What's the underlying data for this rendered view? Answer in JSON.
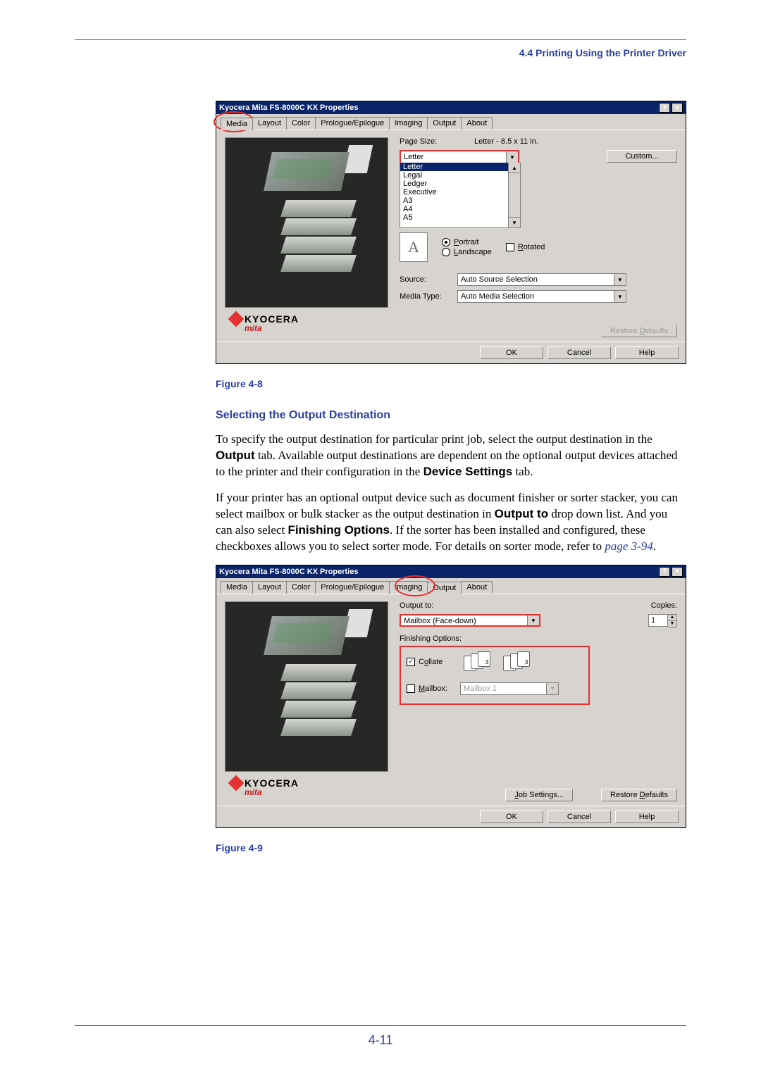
{
  "header": {
    "section": "4.4 Printing Using the Printer Driver"
  },
  "dialog1": {
    "title": "Kyocera Mita FS-8000C KX Properties",
    "tabs": [
      "Media",
      "Layout",
      "Color",
      "Prologue/Epilogue",
      "Imaging",
      "Output",
      "About"
    ],
    "active_tab_index": 0,
    "page_size_label": "Page Size:",
    "page_size_info": "Letter - 8.5 x 11 in.",
    "page_size_selected": "Letter",
    "page_size_options": [
      "Letter",
      "Legal",
      "Ledger",
      "Executive",
      "A3",
      "A4",
      "A5"
    ],
    "custom_btn": "Custom...",
    "orientation_glyph": "A",
    "portrait": "Portrait",
    "landscape": "Landscape",
    "rotated": "Rotated",
    "source_label": "Source:",
    "source_value": "Auto Source Selection",
    "media_type_label": "Media Type:",
    "media_type_value": "Auto Media Selection",
    "logo_top": "KYOCERA",
    "logo_bottom": "mita",
    "restore_defaults": "Restore Defaults",
    "ok": "OK",
    "cancel": "Cancel",
    "help": "Help"
  },
  "fig1_caption": "Figure 4-8",
  "section_title": "Selecting the Output Destination",
  "p1a": "To specify the output destination for particular print job, select the output destination in the ",
  "p1b": "Output",
  "p1c": " tab. Available output destinations are dependent on the optional output devices attached to the printer and their configuration in the ",
  "p1d": "Device Settings",
  "p1e": " tab.",
  "p2a": "If your printer has an optional output device such as document finisher or sorter stacker, you can select mailbox or bulk stacker as the output destination in  ",
  "p2b": "Output to",
  "p2c": " drop down list. And you can also select ",
  "p2d": "Finishing Options",
  "p2e": ". If the sorter has been installed and configured, these checkboxes allows you to select sorter mode. For details on sorter mode, refer to ",
  "p2f": "page 3-94",
  "p2g": ".",
  "dialog2": {
    "title": "Kyocera Mita FS-8000C KX Properties",
    "tabs": [
      "Media",
      "Layout",
      "Color",
      "Prologue/Epilogue",
      "Imaging",
      "Output",
      "About"
    ],
    "active_tab_index": 5,
    "output_to_label": "Output to:",
    "output_to_value": "Mailbox (Face-down)",
    "copies_label": "Copies:",
    "copies_value": "1",
    "finishing_label": "Finishing Options:",
    "collate": "Collate",
    "mailbox": "Mailbox:",
    "mailbox_value": "Mailbox 1",
    "job_settings": "Job Settings...",
    "restore_defaults": "Restore Defaults",
    "ok": "OK",
    "cancel": "Cancel",
    "help": "Help",
    "logo_top": "KYOCERA",
    "logo_bottom": "mita"
  },
  "fig2_caption": "Figure 4-9",
  "page_number": "4-11"
}
